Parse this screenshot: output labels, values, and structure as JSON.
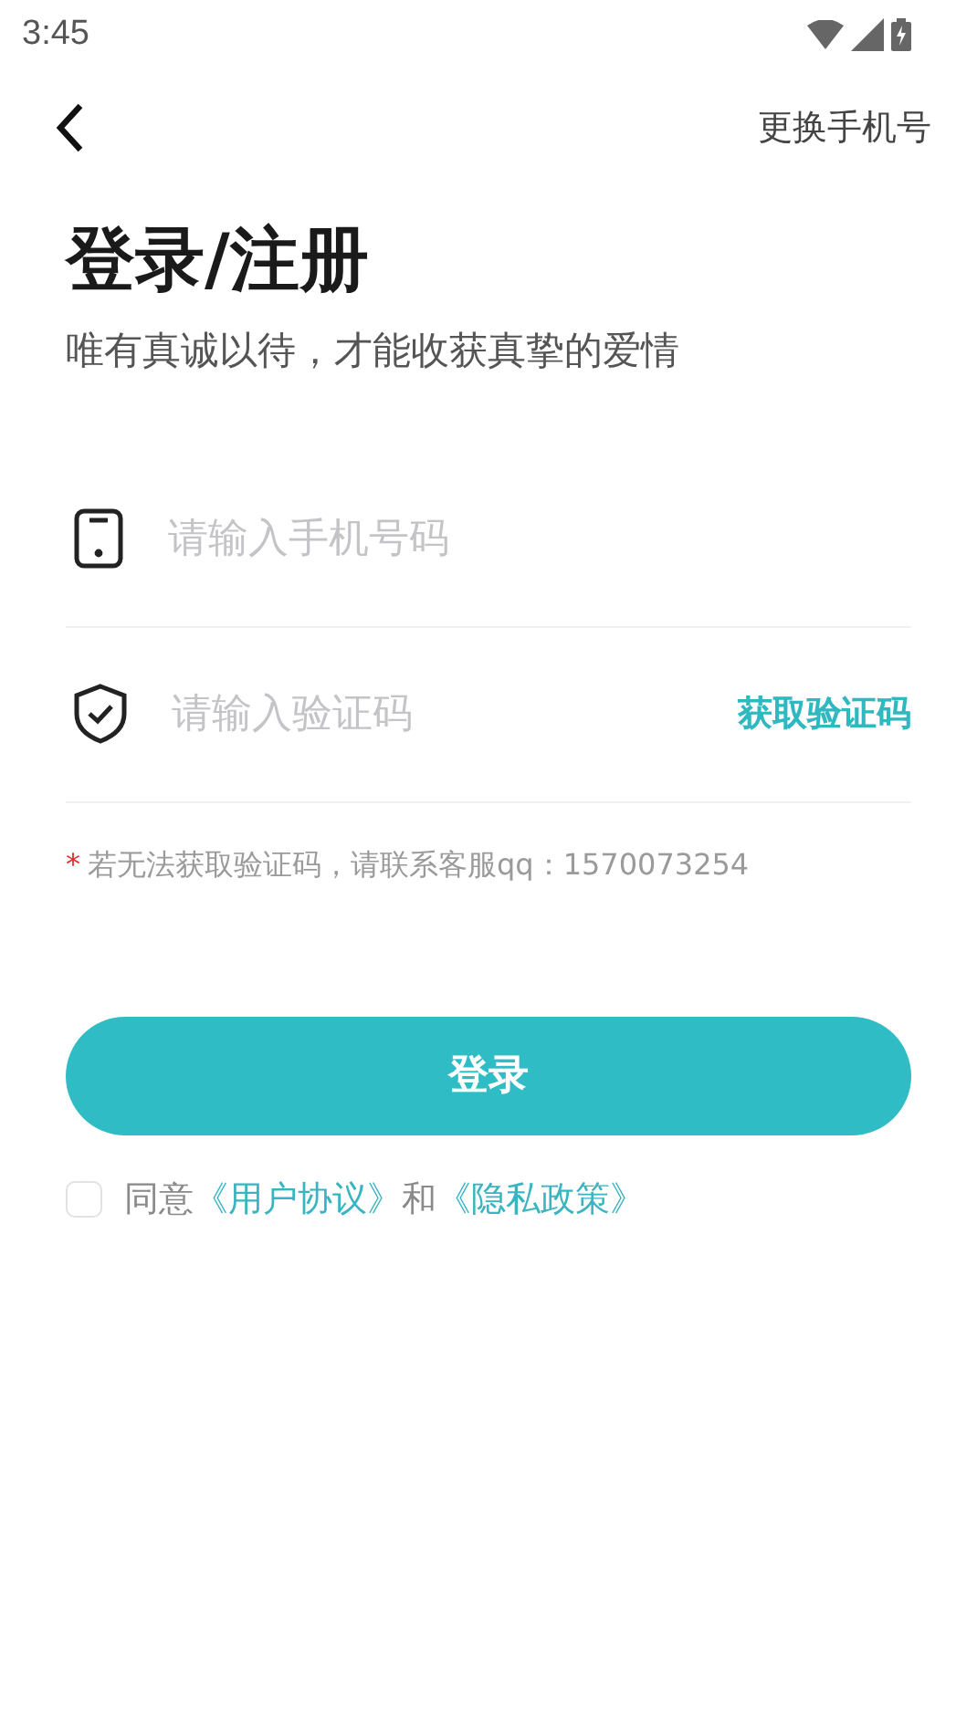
{
  "status_bar": {
    "time": "3:45"
  },
  "nav": {
    "action": "更换手机号"
  },
  "title": "登录/注册",
  "subtitle": "唯有真诚以待，才能收获真挚的爱情",
  "fields": [
    {
      "kind": "phone",
      "placeholder": "请输入手机号码"
    },
    {
      "kind": "code",
      "placeholder": "请输入验证码",
      "action": "获取验证码"
    }
  ],
  "hint": {
    "mark": "*",
    "text": "若无法获取验证码，请联系客服qq：1570073254"
  },
  "login_button": "登录",
  "agreement": {
    "checked": false,
    "prefix": "同意",
    "link1": "《用户协议》",
    "joiner": "和",
    "link2": "《隐私政策》"
  }
}
